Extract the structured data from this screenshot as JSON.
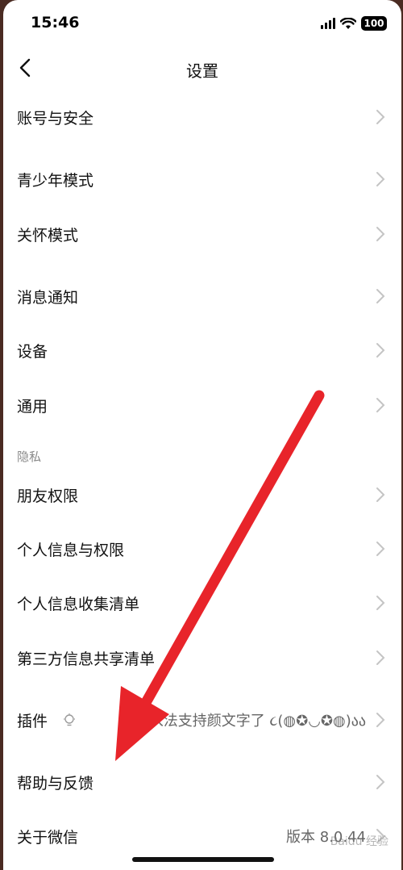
{
  "status": {
    "time": "15:46",
    "battery": "100"
  },
  "nav": {
    "title": "设置"
  },
  "rows": {
    "account": "账号与安全",
    "teen": "青少年模式",
    "care": "关怀模式",
    "notify": "消息通知",
    "device": "设备",
    "general": "通用",
    "privacy_header": "隐私",
    "friends": "朋友权限",
    "personal_info": "个人信息与权限",
    "info_collect": "个人信息收集清单",
    "third_party": "第三方信息共享清单",
    "plugins": "插件",
    "plugins_value": "入法支持颜文字了 ૮(◍✪◡✪◍)აა",
    "help": "帮助与反馈",
    "about": "关于微信",
    "about_value": "版本 8.0.44"
  },
  "watermark": "Baidu 经验",
  "colors": {
    "arrow": "#e8242a",
    "chevron": "#c4c4c4"
  }
}
